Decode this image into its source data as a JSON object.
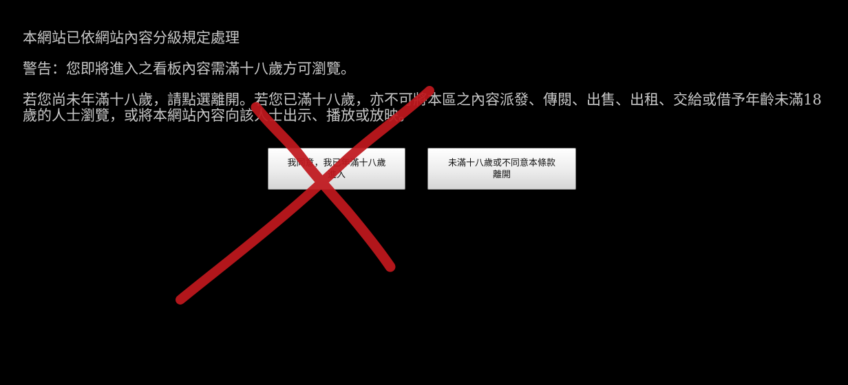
{
  "notice": {
    "line1": "本網站已依網站內容分級規定處理",
    "line2": "警告：您即將進入之看板內容需滿十八歲方可瀏覽。",
    "line3": "若您尚未年滿十八歲，請點選離開。若您已滿十八歲，亦不可將本區之內容派發、傳閱、出售、出租、交給或借予年齡未滿18歲的人士瀏覽，或將本網站內容向該人士出示、播放或放映。"
  },
  "buttons": {
    "agree": {
      "line1": "我同意，我已年滿十八歲",
      "line2": "進入"
    },
    "leave": {
      "line1": "未滿十八歲或不同意本條款",
      "line2": "離開"
    }
  },
  "colors": {
    "background": "#000000",
    "text": "#c8c8c8",
    "cross_mark": "#c0181e"
  },
  "icons": {
    "overlay_mark": "red-cross-mark-icon"
  }
}
